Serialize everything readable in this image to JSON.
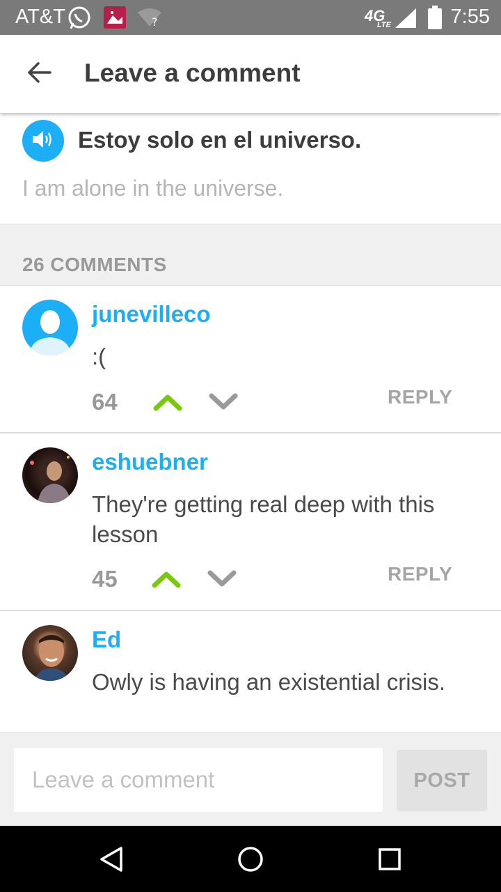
{
  "status_bar": {
    "carrier": "AT&T",
    "network": "4G",
    "network_sub": "LTE",
    "time": "7:55",
    "icons": [
      "whatsapp-icon",
      "notification-app-icon",
      "wifi-question-icon",
      "signal-icon",
      "battery-icon"
    ]
  },
  "app_bar": {
    "back_icon": "arrow-back-icon",
    "title": "Leave a comment"
  },
  "sentence": {
    "speaker_icon": "speaker-icon",
    "text": "Estoy solo en el universo.",
    "translation": "I am alone in the universe."
  },
  "comments": {
    "count_label": "26 COMMENTS",
    "items": [
      {
        "username": "junevilleco",
        "text": ":(",
        "score": "64",
        "reply_label": "REPLY",
        "avatar": "default-avatar"
      },
      {
        "username": "eshuebner",
        "text": "They're getting real deep with this lesson",
        "score": "45",
        "reply_label": "REPLY",
        "avatar": "photo-avatar"
      },
      {
        "username": "Ed",
        "text": "Owly is having an existential crisis.",
        "avatar": "photo-avatar"
      }
    ]
  },
  "composer": {
    "placeholder": "Leave a comment",
    "post_label": "POST"
  },
  "nav_bar": {
    "icons": [
      "back-triangle-icon",
      "home-circle-icon",
      "recents-square-icon"
    ]
  },
  "colors": {
    "accent_blue": "#1caff6",
    "upvote_green": "#7ac70c",
    "status_bar": "#7a7a7a"
  }
}
